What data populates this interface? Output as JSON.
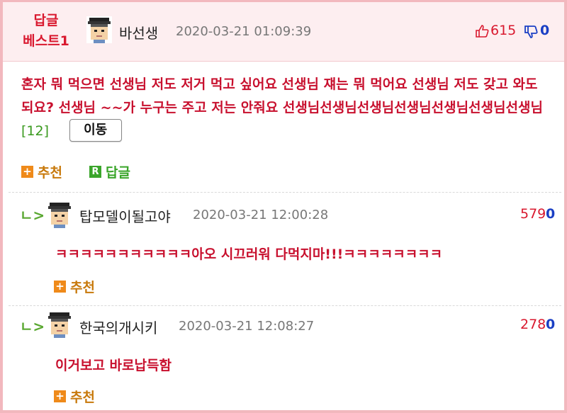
{
  "best": {
    "badge_line1": "답글",
    "badge_line2": "베스트1",
    "nickname": "바선생",
    "date": "2020-03-21 01:09:39",
    "likes": "615",
    "dislikes": "0"
  },
  "post": {
    "text": "혼자 뭐 먹으면 선생님 저도 저거 먹고 싶어요 선생님 쟤는 뭐 먹어요 선생님 저도 갖고 와도 되요? 선생님 ~~가 누구는 주고 저는 안줘요 선생님선생님선생님선생님선생님선생님선생님",
    "reply_count": "[12]",
    "move_label": "이동",
    "recommend_label": "추천",
    "reply_label": "답글"
  },
  "comments": [
    {
      "nickname": "탑모델이될고야",
      "date": "2020-03-21 12:00:28",
      "likes": "579",
      "dislikes": "0",
      "text": "ㅋㅋㅋㅋㅋㅋㅋㅋㅋㅋㅋ아오 시끄러워 다먹지마!!!ㅋㅋㅋㅋㅋㅋㅋㅋ",
      "recommend_label": "추천"
    },
    {
      "nickname": "한국의개시키",
      "date": "2020-03-21 12:08:27",
      "likes": "278",
      "dislikes": "0",
      "text": "이거보고 바로납득함",
      "recommend_label": "추천"
    }
  ],
  "colors": {
    "accent_red": "#c8102e",
    "frame_pink": "#f2b8be",
    "green": "#3aa52a",
    "orange": "#ef8a1a",
    "blue": "#1a3fc4"
  }
}
